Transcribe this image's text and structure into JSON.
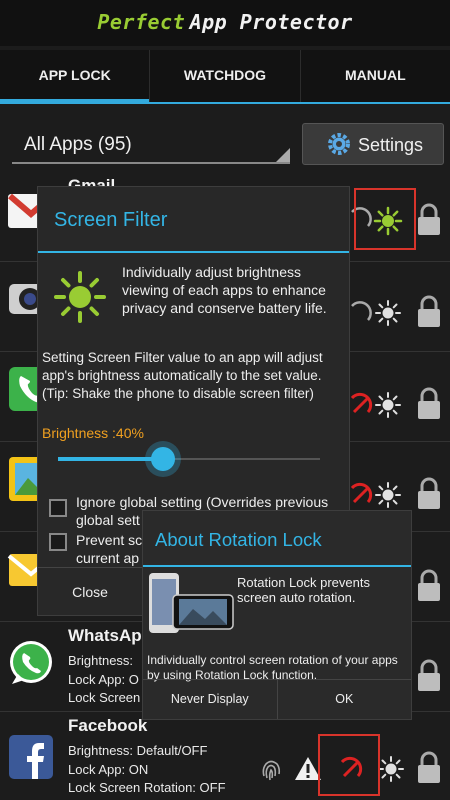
{
  "app": {
    "title_part1": "Perfect",
    "title_part2": "App Protector"
  },
  "tabs": [
    {
      "label": "APP LOCK",
      "active": true
    },
    {
      "label": "WATCHDOG",
      "active": false
    },
    {
      "label": "MANUAL",
      "active": false
    }
  ],
  "filter": {
    "spinner_label": "All Apps (95)",
    "settings_label": "Settings"
  },
  "apps": [
    {
      "name": "Gmail",
      "icon": "gmail-icon"
    },
    {
      "name": "Camera",
      "icon": "camera-icon"
    },
    {
      "name": "Phone",
      "icon": "phone-icon"
    },
    {
      "name": "Gallery",
      "icon": "gallery-icon"
    },
    {
      "name": "Email",
      "icon": "email-icon"
    },
    {
      "name": "WhatsApp",
      "icon": "whatsapp-icon",
      "name_visible": "WhatsAp",
      "brightness": "Brightness:",
      "lock_app": "Lock App: O",
      "lock_screen": "Lock Screen"
    },
    {
      "name": "Facebook",
      "icon": "facebook-icon",
      "brightness": "Brightness: Default/OFF",
      "lock_app": "Lock App: ON",
      "lock_screen": "Lock Screen Rotation: OFF"
    }
  ],
  "screen_filter_dialog": {
    "title": "Screen Filter",
    "description": "Individually adjust brightness viewing of each apps to enhance privacy and conserve battery life.",
    "detail": "Setting Screen Filter value to an app will adjust app's brightness automatically to the set value. (Tip: Shake the phone to disable screen filter)",
    "brightness_label": "Brightness :40%",
    "brightness_value": 0.4,
    "option1_line1": "Ignore global setting (Overrides previous",
    "option1_line2": "global sett",
    "option2_line1": "Prevent sc",
    "option2_line2": "current ap",
    "close_label": "Close"
  },
  "rotation_dialog": {
    "title": "About Rotation Lock",
    "description": "Rotation Lock prevents screen auto rotation.",
    "detail": "Individually control screen rotation of your apps by using Rotation Lock function.",
    "never_display_label": "Never Display",
    "ok_label": "OK"
  },
  "colors": {
    "accent": "#33b5e5",
    "tab_indicator": "#33aadd",
    "highlight": "#d9342b",
    "sun_active": "#99cc33"
  }
}
